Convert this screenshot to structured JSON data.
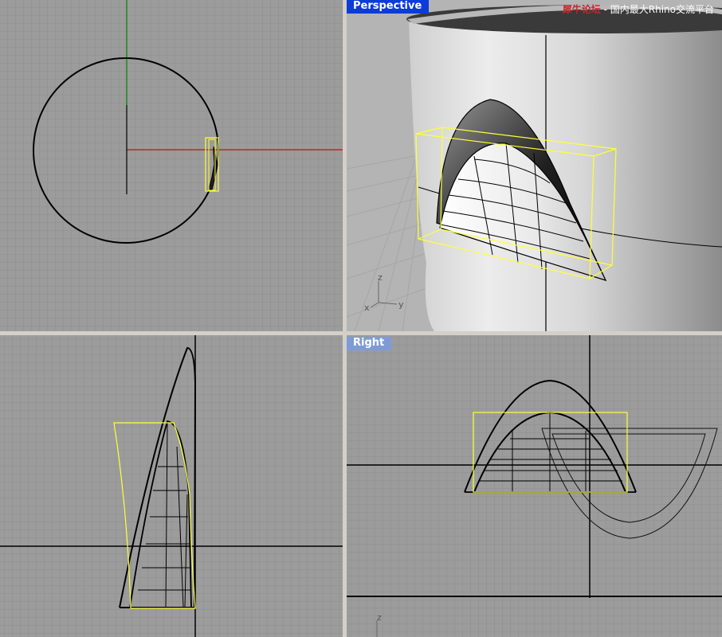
{
  "viewports": {
    "top": {
      "label": ""
    },
    "perspective": {
      "label": "Perspective"
    },
    "front": {
      "label": ""
    },
    "right": {
      "label": "Right"
    }
  },
  "watermark": {
    "site": "犀牛论坛",
    "separator": " - ",
    "tagline": "国内最大Rhino交流平台"
  },
  "axis_labels": {
    "x": "x",
    "y": "y",
    "z": "z"
  },
  "colors": {
    "grid_bg": "#9c9c9c",
    "grid_line": "#8e8e8e",
    "x_axis": "#c0262c",
    "y_axis": "#1f8a1f",
    "selection": "#ffff3a",
    "active_label": "#0a3cd8",
    "inactive_label": "#7f9bd6"
  }
}
